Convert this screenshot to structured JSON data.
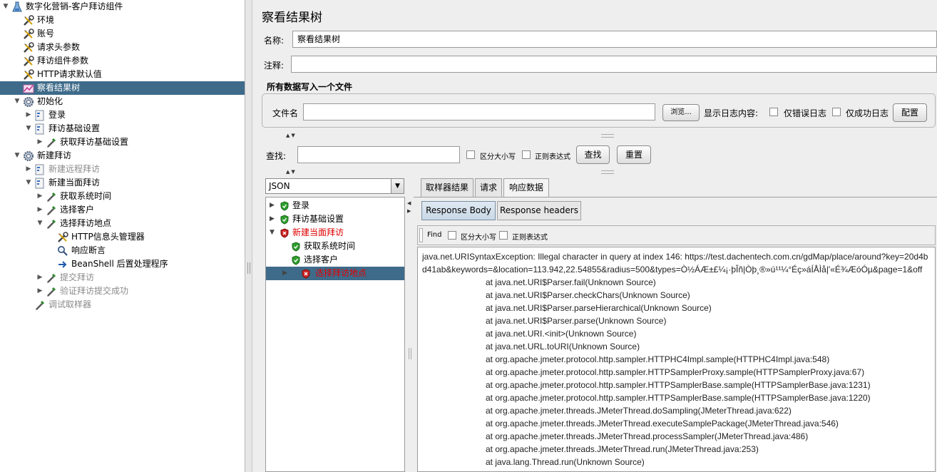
{
  "tree": [
    {
      "label": "数字化营销-客户拜访组件",
      "icon": "flask-icon",
      "toggle": "▼",
      "state": "normal"
    },
    {
      "label": "环境",
      "icon": "wrench-icon",
      "toggle": "",
      "state": "normal"
    },
    {
      "label": "账号",
      "icon": "wrench-icon",
      "toggle": "",
      "state": "normal"
    },
    {
      "label": "请求头参数",
      "icon": "wrench-icon",
      "toggle": "",
      "state": "normal"
    },
    {
      "label": "拜访组件参数",
      "icon": "wrench-icon",
      "toggle": "",
      "state": "normal"
    },
    {
      "label": "HTTP请求默认值",
      "icon": "wrench-icon",
      "toggle": "",
      "state": "normal"
    },
    {
      "label": "察看结果树",
      "icon": "graph-icon",
      "toggle": "",
      "state": "selected"
    },
    {
      "label": "初始化",
      "icon": "gear-icon",
      "toggle": "▼",
      "state": "normal"
    },
    {
      "label": "登录",
      "icon": "controller-icon",
      "toggle": "▶",
      "state": "normal"
    },
    {
      "label": "拜访基础设置",
      "icon": "controller-icon",
      "toggle": "▼",
      "state": "normal"
    },
    {
      "label": "获取拜访基础设置",
      "icon": "pipette-icon",
      "toggle": "▶",
      "state": "normal"
    },
    {
      "label": "新建拜访",
      "icon": "gear-icon",
      "toggle": "▼",
      "state": "normal"
    },
    {
      "label": "新建远程拜访",
      "icon": "controller-icon",
      "toggle": "▶",
      "state": "disabled"
    },
    {
      "label": "新建当面拜访",
      "icon": "controller-icon",
      "toggle": "▼",
      "state": "normal"
    },
    {
      "label": "获取系统时间",
      "icon": "pipette-icon",
      "toggle": "▶",
      "state": "normal"
    },
    {
      "label": "选择客户",
      "icon": "pipette-icon",
      "toggle": "▶",
      "state": "normal"
    },
    {
      "label": "选择拜访地点",
      "icon": "pipette-icon",
      "toggle": "▼",
      "state": "normal"
    },
    {
      "label": "HTTP信息头管理器",
      "icon": "wrench-icon",
      "toggle": "",
      "state": "normal"
    },
    {
      "label": "响应断言",
      "icon": "magnifier-icon",
      "toggle": "",
      "state": "normal"
    },
    {
      "label": "BeanShell 后置处理程序",
      "icon": "arrow-icon",
      "toggle": "",
      "state": "normal"
    },
    {
      "label": "提交拜访",
      "icon": "pipette-icon",
      "toggle": "▶",
      "state": "disabled"
    },
    {
      "label": "验证拜访提交成功",
      "icon": "pipette-icon",
      "toggle": "▶",
      "state": "disabled"
    },
    {
      "label": "调试取样器",
      "icon": "pipette-icon",
      "toggle": "",
      "state": "disabled"
    }
  ],
  "panel": {
    "title": "察看结果树",
    "name_label": "名称:",
    "name_value": "察看结果树",
    "comment_label": "注释:",
    "comment_value": "",
    "file_group_title": "所有数据写入一个文件",
    "file_label": "文件名",
    "file_value": "",
    "browse_button": "浏览...",
    "log_label": "显示日志内容:",
    "errors_only": "仅错误日志",
    "success_only": "仅成功日志",
    "config_button": "配置",
    "search_label": "查找:",
    "search_value": "",
    "case_sensitive": "区分大小写",
    "regex": "正则表达式",
    "search_button": "查找",
    "reset_button": "重置"
  },
  "renderer": {
    "selected": "JSON"
  },
  "result_tree": [
    {
      "label": "登录",
      "toggle": "▶",
      "status": "success"
    },
    {
      "label": "拜访基础设置",
      "toggle": "▶",
      "status": "success"
    },
    {
      "label": "新建当面拜访",
      "toggle": "▼",
      "status": "error"
    },
    {
      "label": "获取系统时间",
      "toggle": "",
      "status": "success"
    },
    {
      "label": "选择客户",
      "toggle": "",
      "status": "success"
    },
    {
      "label": "选择拜访地点",
      "toggle": "▶",
      "status": "error-selected"
    }
  ],
  "tabs": [
    "取样器结果",
    "请求",
    "响应数据"
  ],
  "subtabs": [
    "Response Body",
    "Response headers"
  ],
  "find": {
    "label": "Find",
    "case": "区分大小写",
    "regex": "正则表达式"
  },
  "colors": {
    "selection": "#3e6b8a",
    "error_text": "#e00000",
    "success": "#2f9e2f",
    "error_icon": "#cc2222"
  },
  "response_lines": [
    "java.net.URISyntaxException: Illegal character in query at index 146: https://test.dachentech.com.cn/gdMap/place/around?key=20d4b",
    "d41ab&keywords=&location=113.942,22.54855&radius=500&types=Ò½ÁÆ±£¼¡·þÎñ|Òþ¸®»ú¹¹¼°Éç»áÍÅÌå|'«É¾ÆóÓµ&page=1&off",
    "at java.net.URI$Parser.fail(Unknown Source)",
    "at java.net.URI$Parser.checkChars(Unknown Source)",
    "at java.net.URI$Parser.parseHierarchical(Unknown Source)",
    "at java.net.URI$Parser.parse(Unknown Source)",
    "at java.net.URI.<init>(Unknown Source)",
    "at java.net.URL.toURI(Unknown Source)",
    "at org.apache.jmeter.protocol.http.sampler.HTTPHC4Impl.sample(HTTPHC4Impl.java:548)",
    "at org.apache.jmeter.protocol.http.sampler.HTTPSamplerProxy.sample(HTTPSamplerProxy.java:67)",
    "at org.apache.jmeter.protocol.http.sampler.HTTPSamplerBase.sample(HTTPSamplerBase.java:1231)",
    "at org.apache.jmeter.protocol.http.sampler.HTTPSamplerBase.sample(HTTPSamplerBase.java:1220)",
    "at org.apache.jmeter.threads.JMeterThread.doSampling(JMeterThread.java:622)",
    "at org.apache.jmeter.threads.JMeterThread.executeSamplePackage(JMeterThread.java:546)",
    "at org.apache.jmeter.threads.JMeterThread.processSampler(JMeterThread.java:486)",
    "at org.apache.jmeter.threads.JMeterThread.run(JMeterThread.java:253)",
    "at java.lang.Thread.run(Unknown Source)"
  ]
}
